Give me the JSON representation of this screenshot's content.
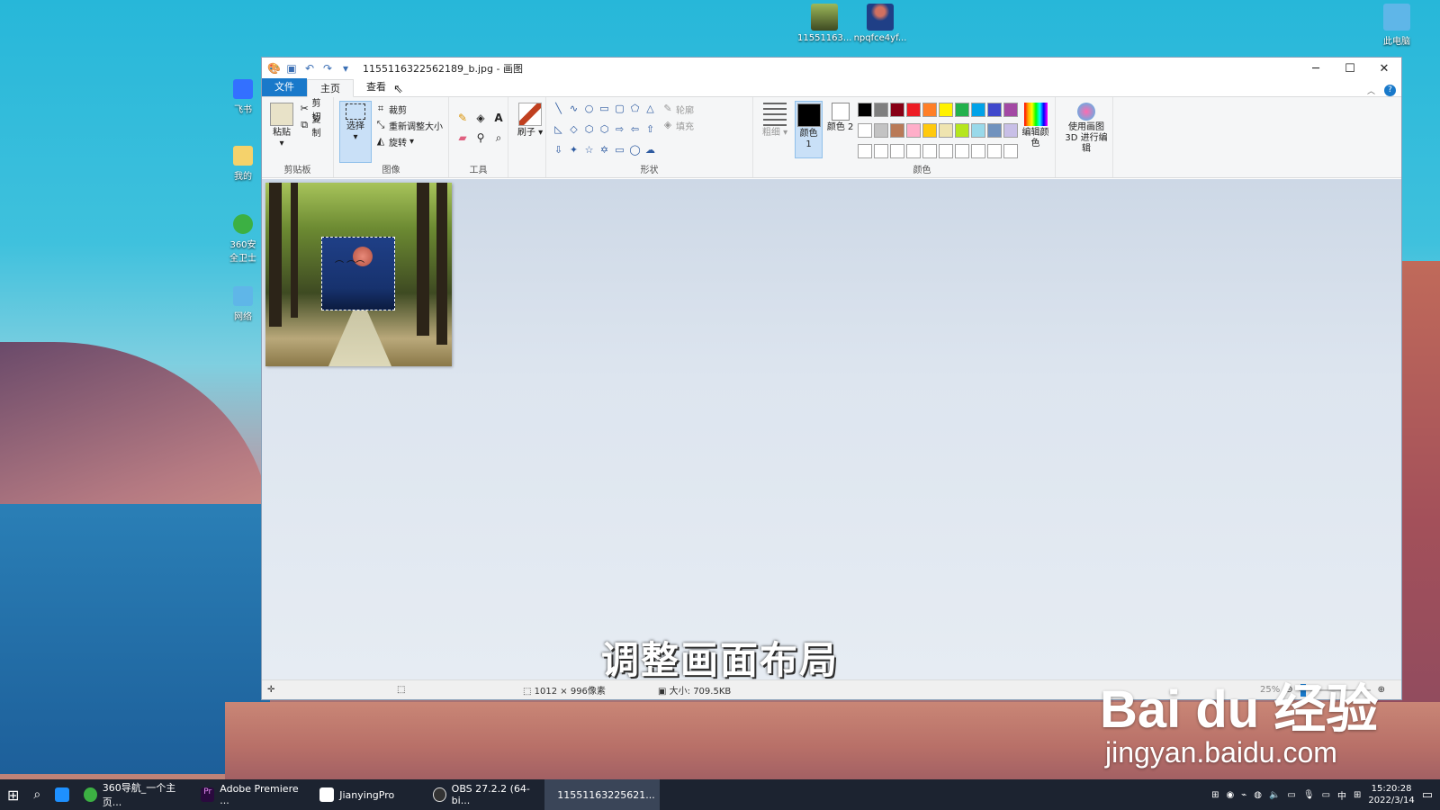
{
  "desktop": {
    "icons_top": [
      {
        "label": "11551163..."
      },
      {
        "label": "npqfce4yf..."
      },
      {
        "label": "此电脑"
      }
    ],
    "icons_left": [
      {
        "label": "飞书"
      },
      {
        "label": "我的"
      },
      {
        "label": "360安全卫士"
      },
      {
        "label": "网络"
      }
    ]
  },
  "window": {
    "title": "1155116322562189_b.jpg - 画图",
    "tabs": {
      "file": "文件",
      "home": "主页",
      "view": "查看"
    }
  },
  "ribbon": {
    "clipboard": {
      "paste": "粘贴",
      "cut": "剪切",
      "copy": "复制",
      "label": "剪贴板"
    },
    "image": {
      "select": "选择",
      "crop": "裁剪",
      "resize": "重新调整大小",
      "rotate": "旋转",
      "label": "图像"
    },
    "tools": {
      "label": "工具"
    },
    "brush": {
      "label": "刷子"
    },
    "shapes": {
      "outline": "轮廓",
      "fill": "填充",
      "label": "形状"
    },
    "size": {
      "label": "粗细"
    },
    "colors": {
      "color1": "颜色 1",
      "color2": "颜色 2",
      "edit": "编辑颜色",
      "label": "颜色",
      "palette": [
        "#000000",
        "#7f7f7f",
        "#880015",
        "#ed1c24",
        "#ff7f27",
        "#fff200",
        "#22b14c",
        "#00a2e8",
        "#3f48cc",
        "#a349a4",
        "#ffffff",
        "#c3c3c3",
        "#b97a57",
        "#ffaec9",
        "#ffc90e",
        "#efe4b0",
        "#b5e61d",
        "#99d9ea",
        "#7092be",
        "#c8bfe7",
        "#ffffff",
        "#ffffff",
        "#ffffff",
        "#ffffff",
        "#ffffff",
        "#ffffff",
        "#ffffff",
        "#ffffff",
        "#ffffff",
        "#ffffff"
      ]
    },
    "paint3d": "使用画图 3D 进行编辑"
  },
  "status": {
    "dimensions": "1012 × 996像素",
    "size": "大小: 709.5KB",
    "zoom": "25%"
  },
  "overlay": {
    "subtitle": "调整画面布局",
    "watermark_logo": "Bai du 经验",
    "watermark_url": "jingyan.baidu.com"
  },
  "taskbar": {
    "apps": [
      {
        "label": "360导航_一个主页..."
      },
      {
        "label": "Adobe Premiere ..."
      },
      {
        "label": "JianyingPro"
      },
      {
        "label": "OBS 27.2.2 (64-bi..."
      },
      {
        "label": "11551163225621..."
      }
    ],
    "ime": "中",
    "time": "15:20:28",
    "date": "2022/3/14"
  }
}
